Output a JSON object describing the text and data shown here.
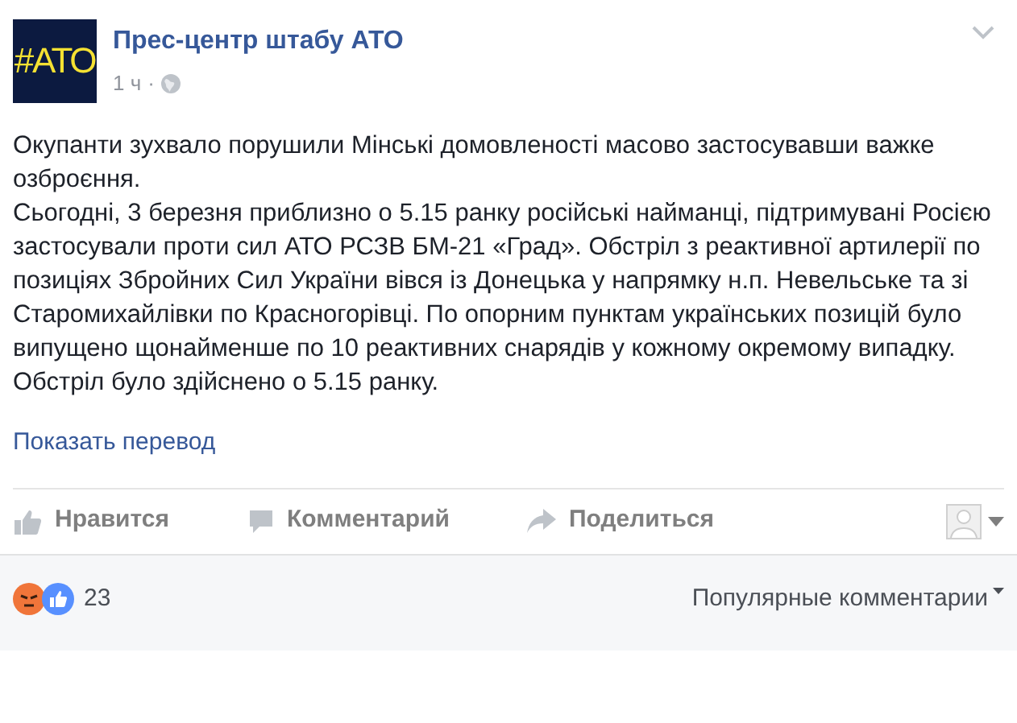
{
  "post": {
    "author": "Прес-центр штабу АТО",
    "avatar_text": "#АТО",
    "time": "1 ч",
    "separator": "·",
    "paragraphs": [
      "Окупанти зухвало порушили Мінські домовленості масово застосувавши важке озброєння.",
      "Сьогодні, 3 березня приблизно о 5.15 ранку російські найманці, підтримувані Росією застосували проти сил АТО РСЗВ БМ-21 «Град». Обстріл з реактивної артилерії по позиціях Збройних Сил України вівся із Донецька у напрямку н.п. Невельське та зі Старомихайлівки по Красногорівці. По опорним пунктам українських позицій було випущено щонайменше по 10 реактивних снарядів у кожному окремому випадку. Обстріл було здійснено о 5.15 ранку."
    ],
    "translate_link": "Показать перевод"
  },
  "actions": [
    {
      "kind": "like",
      "label": "Нравится"
    },
    {
      "kind": "comment",
      "label": "Комментарий"
    },
    {
      "kind": "share",
      "label": "Поделиться"
    }
  ],
  "reactions": {
    "count": "23"
  },
  "sort": {
    "label": "Популярные комментарии"
  }
}
